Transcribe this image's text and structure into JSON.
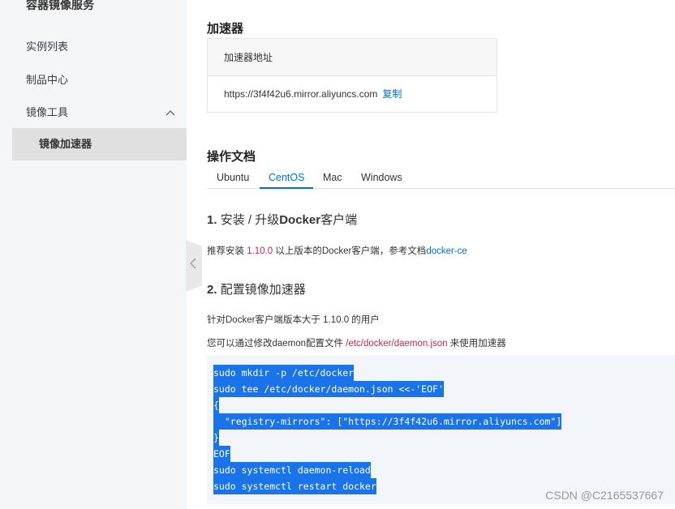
{
  "sidebar": {
    "cut_title": "容器镜像服务",
    "items": [
      {
        "label": "实例列表"
      },
      {
        "label": "制品中心"
      },
      {
        "label": "镜像工具",
        "chevron": "chevron-up-icon"
      },
      {
        "label": "镜像加速器",
        "active": true
      }
    ]
  },
  "accelerator": {
    "title": "加速器",
    "header": "加速器地址",
    "address": "https://3f4f42u6.mirror.aliyuncs.com",
    "copy_label": "复制"
  },
  "docs": {
    "title": "操作文档",
    "tabs": [
      "Ubuntu",
      "CentOS",
      "Mac",
      "Windows"
    ],
    "active_tab": "CentOS",
    "step1": {
      "num": "1.",
      "pre": "安装 / 升级",
      "bold": "Docker",
      "post": "客户端"
    },
    "step1_text": {
      "pre": "推荐安装 ",
      "version": "1.10.0",
      "mid": " 以上版本的Docker客户端，参考文档",
      "link": "docker-ce"
    },
    "step2": {
      "num": "2.",
      "text": "配置镜像加速器"
    },
    "step2_text1": "针对Docker客户端版本大于 1.10.0 的用户",
    "step2_text2": {
      "pre": "您可以通过修改daemon配置文件 ",
      "path": "/etc/docker/daemon.json",
      "post": " 来使用加速器"
    },
    "code_lines": [
      "sudo mkdir -p /etc/docker",
      "sudo tee /etc/docker/daemon.json <<-'EOF'",
      "{",
      "  \"registry-mirrors\": [\"https://3f4f42u6.mirror.aliyuncs.com\"]",
      "}",
      "EOF",
      "sudo systemctl daemon-reload",
      "sudo systemctl restart docker"
    ]
  },
  "watermark": "CSDN @C2165537667",
  "colors": {
    "accent": "#0070cc",
    "selection": "#1a73e8",
    "version_red": "#c7254e"
  }
}
